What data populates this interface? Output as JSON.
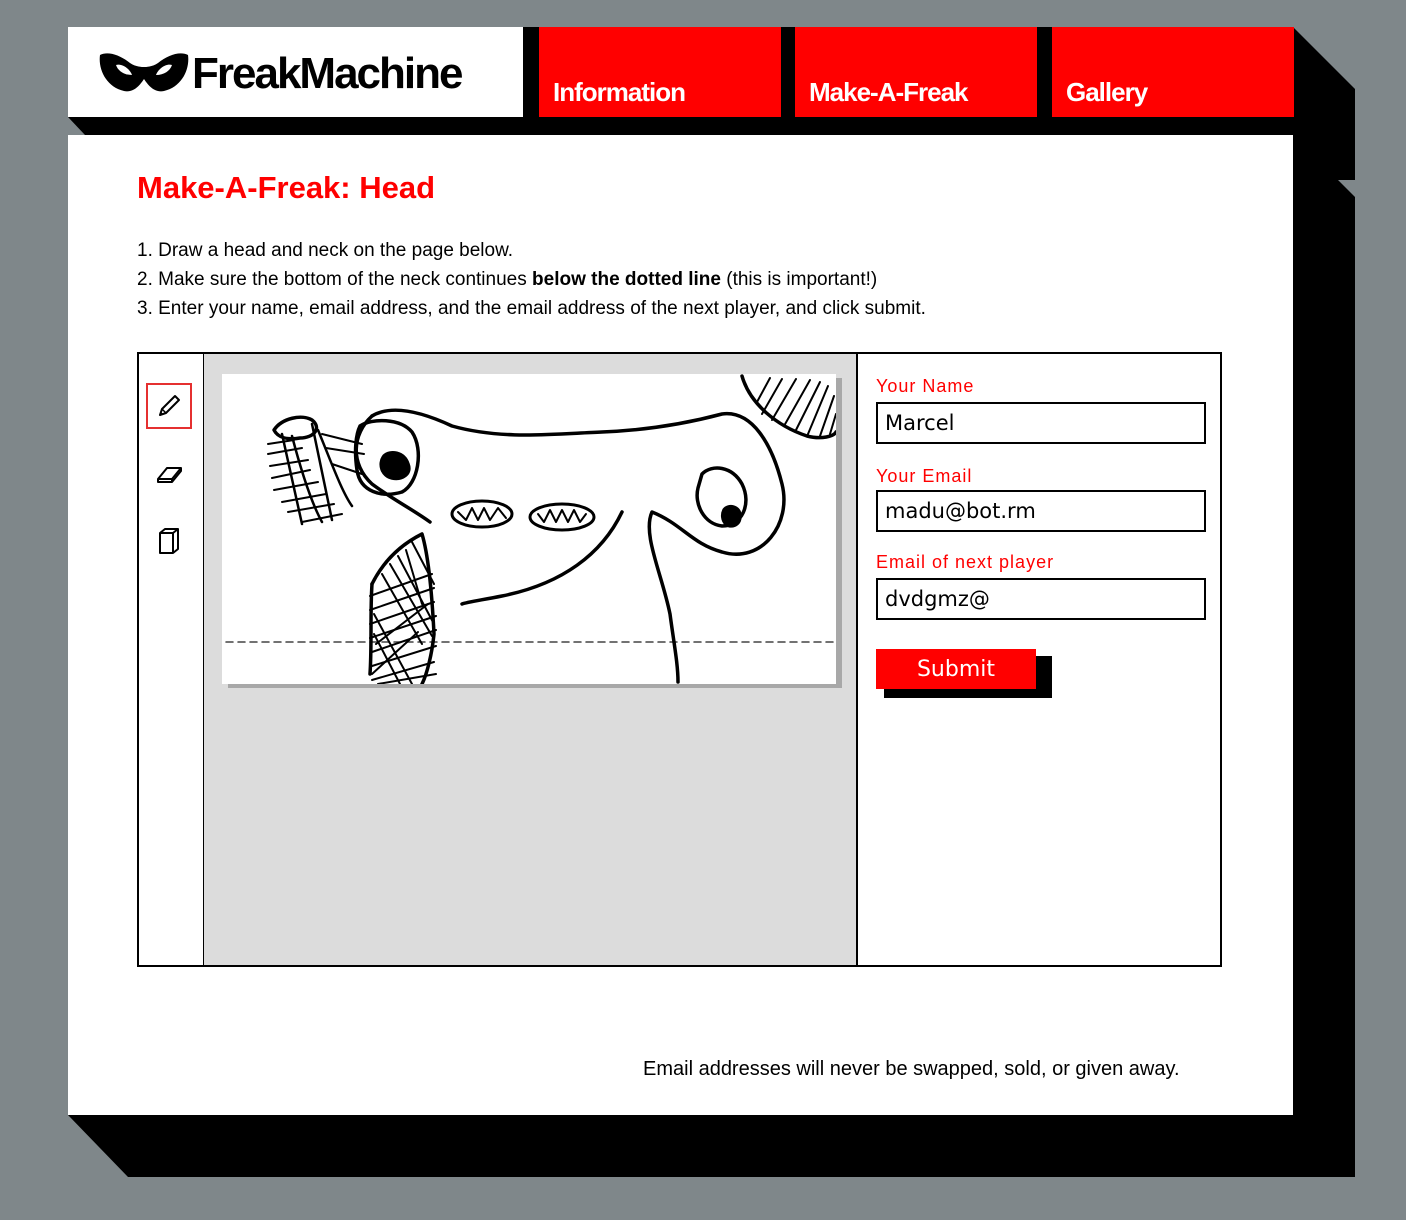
{
  "brand": {
    "name": "FreakMachine",
    "logo_icon": "mask-icon"
  },
  "nav": {
    "tabs": [
      {
        "label": "Information"
      },
      {
        "label": "Make-A-Freak"
      },
      {
        "label": "Gallery"
      }
    ]
  },
  "page": {
    "title": "Make-A-Freak: Head",
    "steps": [
      {
        "prefix": "1. Draw a head and neck on the page below.",
        "bold": "",
        "suffix": ""
      },
      {
        "prefix": "2. Make sure the bottom of the neck continues ",
        "bold": "below the dotted line",
        "suffix": " (this is important!)"
      },
      {
        "prefix": "3. Enter your name, email address, and the email address of the next player, and click submit.",
        "bold": "",
        "suffix": ""
      }
    ]
  },
  "tools": [
    {
      "icon": "pencil-icon",
      "active": true
    },
    {
      "icon": "eraser-icon",
      "active": false
    },
    {
      "icon": "blank-page-icon",
      "active": false
    }
  ],
  "form": {
    "name_label": "Your Name",
    "name_value": "Marcel",
    "email_label": "Your Email",
    "email_value": "madu@bot.rm",
    "next_label": "Email of next player",
    "next_value": "dvdgmz@",
    "submit_label": "Submit"
  },
  "footer": {
    "note": "Email addresses will never be swapped, sold, or given away."
  },
  "colors": {
    "background": "#7f878a",
    "accent": "#ff0000",
    "shadow": "#000000",
    "canvas_bg": "#dcdcdc"
  }
}
